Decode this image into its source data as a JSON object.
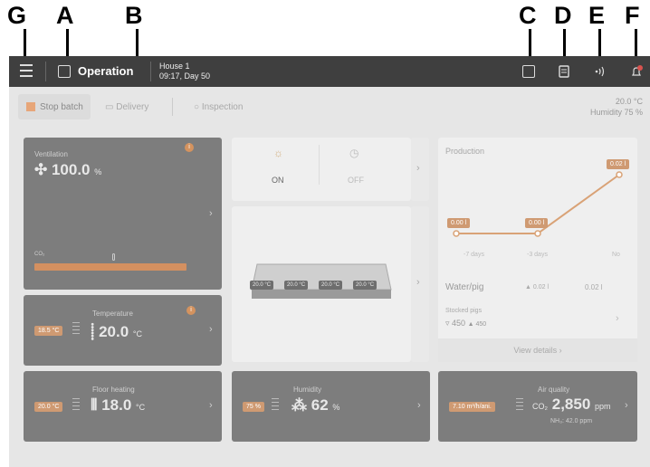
{
  "callouts": [
    "G",
    "A",
    "B",
    "C",
    "D",
    "E",
    "F"
  ],
  "topbar": {
    "title": "Operation",
    "house": "House 1",
    "time": "09:17, Day 50",
    "notification_badge": "1"
  },
  "subbar": {
    "stop_batch": "Stop batch",
    "delivery": "Delivery",
    "inspection": "Inspection",
    "temp": "20.0 °C",
    "humidity": "Humidity 75 %"
  },
  "ventilation": {
    "label": "Ventilation",
    "value": "100.0",
    "unit": "%",
    "co2": "CO₂",
    "info": "i"
  },
  "lights": {
    "on": "ON",
    "off": "OFF"
  },
  "sensors": [
    "20.0 °C",
    "20.0 °C",
    "20.0 °C",
    "20.0 °C"
  ],
  "temperature": {
    "label": "Temperature",
    "setpoint": "18.5 °C",
    "value": "20.0",
    "unit": "°C",
    "info": "i"
  },
  "production": {
    "title": "Production",
    "labels": [
      "0.00 l",
      "0.00 l",
      "0.02 l"
    ],
    "x_labels": [
      "-7 days",
      "-3 days",
      "No"
    ],
    "water_label": "Water/pig",
    "water_delta": "▲ 0.02 l",
    "water_value": "0.02 l",
    "stocked_label": "Stocked pigs",
    "stocked_value": "450",
    "stocked_delta": "▲ 450",
    "view_details": "View details  ›"
  },
  "floor_heating": {
    "label": "Floor heating",
    "setpoint": "20.0 °C",
    "value": "18.0",
    "unit": "°C"
  },
  "humidity": {
    "label": "Humidity",
    "setpoint": "75 %",
    "value": "62",
    "unit": "%"
  },
  "air_quality": {
    "label": "Air quality",
    "setpoint": "7.10 m³/h/ani.",
    "co2": "CO₂",
    "value": "2,850",
    "unit": "ppm",
    "nh3": "NH₃: 42.0 ppm"
  },
  "colors": {
    "accent": "#d4935f",
    "dark_card": "#7d7d7d",
    "topbar": "#3f3f3f"
  }
}
